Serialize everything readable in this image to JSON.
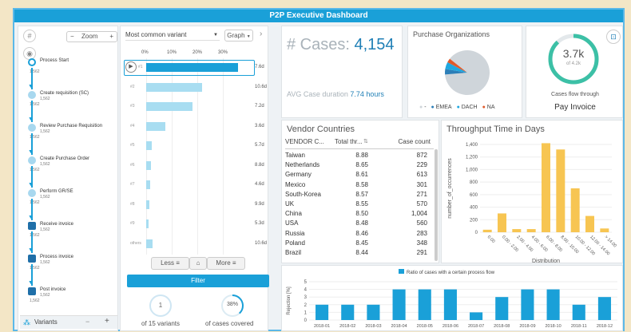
{
  "app": {
    "title": "P2P Executive Dashboard"
  },
  "process_map": {
    "zoom_label": "Zoom",
    "zoom_minus": "−",
    "zoom_plus": "+",
    "start_label": "Process Start",
    "nodes": [
      {
        "label": "Create requisition (SC)",
        "count": "1,562"
      },
      {
        "label": "Review Purchase Requisition",
        "count": "1,562"
      },
      {
        "label": "Create Purchase Order",
        "count": "1,562"
      },
      {
        "label": "Perform GR/SE",
        "count": "1,562"
      },
      {
        "label": "Receive invoice",
        "count": "1,562"
      },
      {
        "label": "Process invoice",
        "count": "1,562"
      },
      {
        "label": "Post invoice",
        "count": "1,562"
      }
    ],
    "edge_count": "1,562",
    "variants_tab": "Variants",
    "variants_minus": "−",
    "variants_plus": "+"
  },
  "variants": {
    "select_value": "Most common variant",
    "graph_select": "Graph",
    "axis_ticks": [
      "0%",
      "10%",
      "20%",
      "30%"
    ],
    "rows": [
      {
        "label": "#1",
        "pct": 36,
        "dur": "7.6d",
        "selected": true
      },
      {
        "label": "#2",
        "pct": 22,
        "dur": "10.6d",
        "selected": false
      },
      {
        "label": "#3",
        "pct": 18,
        "dur": "7.2d",
        "selected": false
      },
      {
        "label": "#4",
        "pct": 7.5,
        "dur": "3.6d",
        "selected": false
      },
      {
        "label": "#5",
        "pct": 2.2,
        "dur": "5.7d",
        "selected": false
      },
      {
        "label": "#6",
        "pct": 2.0,
        "dur": "8.8d",
        "selected": false
      },
      {
        "label": "#7",
        "pct": 1.6,
        "dur": "4.6d",
        "selected": false
      },
      {
        "label": "#8",
        "pct": 1.2,
        "dur": "9.9d",
        "selected": false
      },
      {
        "label": "#9",
        "pct": 1.0,
        "dur": "5.3d",
        "selected": false
      },
      {
        "label": "others",
        "pct": 2.5,
        "dur": "10.6d",
        "selected": false
      }
    ],
    "less_label": "Less",
    "more_label": "More",
    "filter_label": "Filter",
    "variants_count": "1",
    "variants_caption": "of 15 variants",
    "cases_pct": "38%",
    "cases_caption": "of cases covered",
    "cases_fraction": 0.38
  },
  "kpi": {
    "cases_label": "# Cases:",
    "cases_value": "4,154",
    "avg_label": "AVG Case duration",
    "avg_value": "7.74 hours"
  },
  "purchase_orgs": {
    "title": "Purchase Organizations",
    "legend": [
      {
        "label": "-",
        "color": "#cfd5da"
      },
      {
        "label": "EMEA",
        "color": "#2c7fb8"
      },
      {
        "label": "DACH",
        "color": "#1fa8e0"
      },
      {
        "label": "NA",
        "color": "#e05a2a"
      }
    ],
    "chart_data": {
      "type": "pie",
      "labels": [
        "-",
        "EMEA",
        "DACH",
        "NA"
      ],
      "values": [
        88,
        4,
        5,
        3
      ]
    }
  },
  "gauge": {
    "value": "3.7k",
    "sub": "of 4.2k",
    "fraction": 0.88,
    "caption": "Cases flow through",
    "activity": "Pay Invoice"
  },
  "vendor_countries": {
    "title": "Vendor Countries",
    "columns": [
      "VENDOR C...",
      "Total thr...",
      "Case count"
    ],
    "rows": [
      [
        "Taiwan",
        "8.88",
        "872"
      ],
      [
        "Netherlands",
        "8.65",
        "229"
      ],
      [
        "Germany",
        "8.61",
        "613"
      ],
      [
        "Mexico",
        "8.58",
        "301"
      ],
      [
        "South-Korea",
        "8.57",
        "271"
      ],
      [
        "UK",
        "8.55",
        "570"
      ],
      [
        "China",
        "8.50",
        "1,004"
      ],
      [
        "USA",
        "8.48",
        "560"
      ],
      [
        "Russia",
        "8.46",
        "283"
      ],
      [
        "Poland",
        "8.45",
        "348"
      ],
      [
        "Brazil",
        "8.44",
        "291"
      ]
    ]
  },
  "throughput": {
    "title": "Throughput Time in Days",
    "chart_data": {
      "type": "bar",
      "categories": [
        "0.00",
        "0.00 - 2.00",
        "2.00 - 4.00",
        "4.00 - 6.00",
        "6.00 - 8.00",
        "8.00 - 10.00",
        "10.00 - 12.00",
        "12.00 - 14.00",
        "> 14.00"
      ],
      "values": [
        40,
        300,
        50,
        50,
        1420,
        1320,
        700,
        260,
        60
      ],
      "ylim": [
        0,
        1400
      ],
      "yticks": [
        "0",
        "200",
        "400",
        "600",
        "800",
        "1,000",
        "1,200",
        "1,400"
      ],
      "xlabel": "Distribution",
      "ylabel": "number_of_occurrences",
      "color": "#f7c552"
    }
  },
  "rejection": {
    "title": "Ratio of cases with a certain process flow",
    "chart_data": {
      "type": "bar",
      "categories": [
        "2018-01",
        "2018-02",
        "2018-03",
        "2018-04",
        "2018-05",
        "2018-06",
        "2018-07",
        "2018-08",
        "2018-09",
        "2018-10",
        "2018-11",
        "2018-12"
      ],
      "values": [
        2,
        2,
        2,
        4,
        4,
        4,
        1,
        3,
        4,
        4,
        2,
        3
      ],
      "ylim": [
        0,
        5
      ],
      "yticks": [
        "0",
        "1",
        "2",
        "3",
        "4",
        "5"
      ],
      "ylabel": "Rejection [%]",
      "color": "#1aa0d8"
    }
  }
}
